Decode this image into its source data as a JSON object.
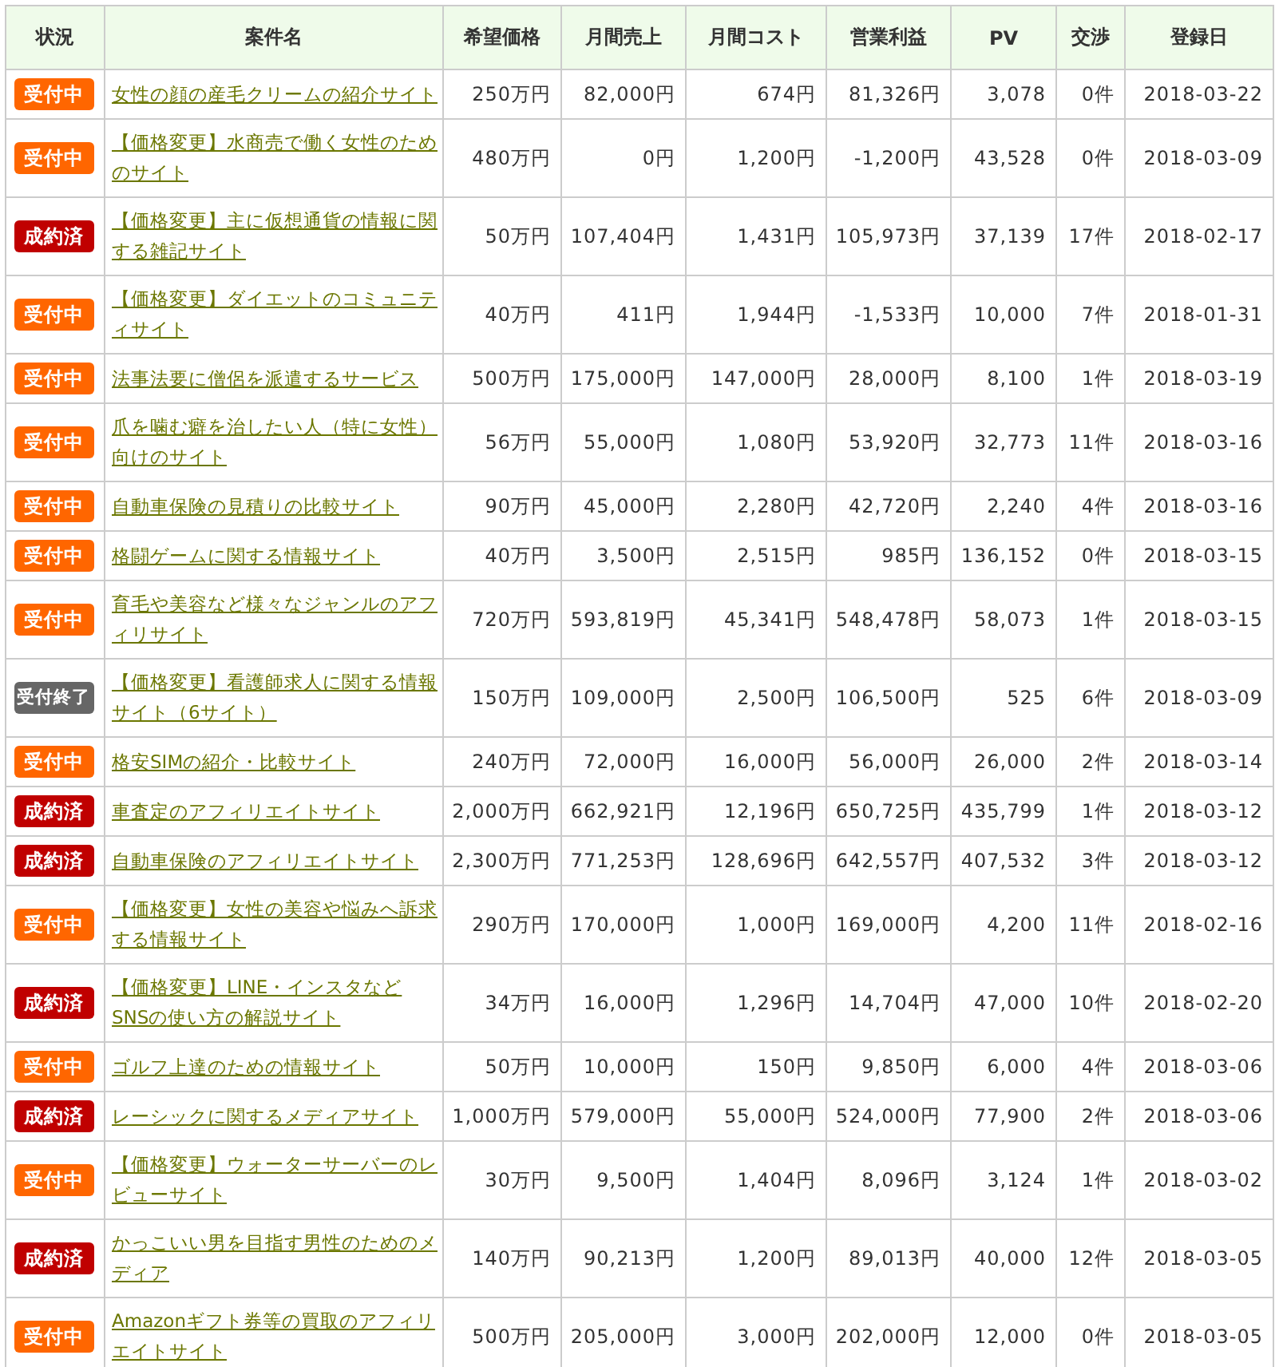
{
  "table": {
    "columns": [
      "状況",
      "案件名",
      "希望価格",
      "月間売上",
      "月間コスト",
      "営業利益",
      "PV",
      "交渉",
      "登録日"
    ],
    "rows": [
      {
        "status": {
          "label": "受付中",
          "kind": "open"
        },
        "name": "女性の顔の産毛クリームの紹介サイト",
        "price": "250万円",
        "sales": "82,000円",
        "cost": "674円",
        "profit": "81,326円",
        "pv": "3,078",
        "offers": "0件",
        "date": "2018-03-22"
      },
      {
        "status": {
          "label": "受付中",
          "kind": "open"
        },
        "name": "【価格変更】水商売で働く女性のためのサイト",
        "price": "480万円",
        "sales": "0円",
        "cost": "1,200円",
        "profit": "-1,200円",
        "pv": "43,528",
        "offers": "0件",
        "date": "2018-03-09"
      },
      {
        "status": {
          "label": "成約済",
          "kind": "closed"
        },
        "name": "【価格変更】主に仮想通貨の情報に関する雑記サイト",
        "price": "50万円",
        "sales": "107,404円",
        "cost": "1,431円",
        "profit": "105,973円",
        "pv": "37,139",
        "offers": "17件",
        "date": "2018-02-17"
      },
      {
        "status": {
          "label": "受付中",
          "kind": "open"
        },
        "name": "【価格変更】ダイエットのコミュニティサイト",
        "price": "40万円",
        "sales": "411円",
        "cost": "1,944円",
        "profit": "-1,533円",
        "pv": "10,000",
        "offers": "7件",
        "date": "2018-01-31"
      },
      {
        "status": {
          "label": "受付中",
          "kind": "open"
        },
        "name": "法事法要に僧侶を派遣するサービス",
        "price": "500万円",
        "sales": "175,000円",
        "cost": "147,000円",
        "profit": "28,000円",
        "pv": "8,100",
        "offers": "1件",
        "date": "2018-03-19"
      },
      {
        "status": {
          "label": "受付中",
          "kind": "open"
        },
        "name": "爪を噛む癖を治したい人（特に女性）向けのサイト",
        "price": "56万円",
        "sales": "55,000円",
        "cost": "1,080円",
        "profit": "53,920円",
        "pv": "32,773",
        "offers": "11件",
        "date": "2018-03-16"
      },
      {
        "status": {
          "label": "受付中",
          "kind": "open"
        },
        "name": "自動車保険の見積りの比較サイト",
        "price": "90万円",
        "sales": "45,000円",
        "cost": "2,280円",
        "profit": "42,720円",
        "pv": "2,240",
        "offers": "4件",
        "date": "2018-03-16"
      },
      {
        "status": {
          "label": "受付中",
          "kind": "open"
        },
        "name": "格闘ゲームに関する情報サイト",
        "price": "40万円",
        "sales": "3,500円",
        "cost": "2,515円",
        "profit": "985円",
        "pv": "136,152",
        "offers": "0件",
        "date": "2018-03-15"
      },
      {
        "status": {
          "label": "受付中",
          "kind": "open"
        },
        "name": "育毛や美容など様々なジャンルのアフィリサイト",
        "price": "720万円",
        "sales": "593,819円",
        "cost": "45,341円",
        "profit": "548,478円",
        "pv": "58,073",
        "offers": "1件",
        "date": "2018-03-15"
      },
      {
        "status": {
          "label": "受付終了",
          "kind": "ended"
        },
        "name": "【価格変更】看護師求人に関する情報サイト（6サイト）",
        "price": "150万円",
        "sales": "109,000円",
        "cost": "2,500円",
        "profit": "106,500円",
        "pv": "525",
        "offers": "6件",
        "date": "2018-03-09"
      },
      {
        "status": {
          "label": "受付中",
          "kind": "open"
        },
        "name": "格安SIMの紹介・比較サイト",
        "price": "240万円",
        "sales": "72,000円",
        "cost": "16,000円",
        "profit": "56,000円",
        "pv": "26,000",
        "offers": "2件",
        "date": "2018-03-14"
      },
      {
        "status": {
          "label": "成約済",
          "kind": "closed"
        },
        "name": "車査定のアフィリエイトサイト",
        "price": "2,000万円",
        "sales": "662,921円",
        "cost": "12,196円",
        "profit": "650,725円",
        "pv": "435,799",
        "offers": "1件",
        "date": "2018-03-12"
      },
      {
        "status": {
          "label": "成約済",
          "kind": "closed"
        },
        "name": "自動車保険のアフィリエイトサイト",
        "price": "2,300万円",
        "sales": "771,253円",
        "cost": "128,696円",
        "profit": "642,557円",
        "pv": "407,532",
        "offers": "3件",
        "date": "2018-03-12"
      },
      {
        "status": {
          "label": "受付中",
          "kind": "open"
        },
        "name": "【価格変更】女性の美容や悩みへ訴求する情報サイト",
        "price": "290万円",
        "sales": "170,000円",
        "cost": "1,000円",
        "profit": "169,000円",
        "pv": "4,200",
        "offers": "11件",
        "date": "2018-02-16"
      },
      {
        "status": {
          "label": "成約済",
          "kind": "closed"
        },
        "name": "【価格変更】LINE・インスタなどSNSの使い方の解説サイト",
        "price": "34万円",
        "sales": "16,000円",
        "cost": "1,296円",
        "profit": "14,704円",
        "pv": "47,000",
        "offers": "10件",
        "date": "2018-02-20"
      },
      {
        "status": {
          "label": "受付中",
          "kind": "open"
        },
        "name": "ゴルフ上達のための情報サイト",
        "price": "50万円",
        "sales": "10,000円",
        "cost": "150円",
        "profit": "9,850円",
        "pv": "6,000",
        "offers": "4件",
        "date": "2018-03-06"
      },
      {
        "status": {
          "label": "成約済",
          "kind": "closed"
        },
        "name": "レーシックに関するメディアサイト",
        "price": "1,000万円",
        "sales": "579,000円",
        "cost": "55,000円",
        "profit": "524,000円",
        "pv": "77,900",
        "offers": "2件",
        "date": "2018-03-06"
      },
      {
        "status": {
          "label": "受付中",
          "kind": "open"
        },
        "name": "【価格変更】ウォーターサーバーのレビューサイト",
        "price": "30万円",
        "sales": "9,500円",
        "cost": "1,404円",
        "profit": "8,096円",
        "pv": "3,124",
        "offers": "1件",
        "date": "2018-03-02"
      },
      {
        "status": {
          "label": "成約済",
          "kind": "closed"
        },
        "name": "かっこいい男を目指す男性のためのメディア",
        "price": "140万円",
        "sales": "90,213円",
        "cost": "1,200円",
        "profit": "89,013円",
        "pv": "40,000",
        "offers": "12件",
        "date": "2018-03-05"
      },
      {
        "status": {
          "label": "受付中",
          "kind": "open"
        },
        "name": "Amazonギフト券等の買取のアフィリエイトサイト",
        "price": "500万円",
        "sales": "205,000円",
        "cost": "3,000円",
        "profit": "202,000円",
        "pv": "12,000",
        "offers": "0件",
        "date": "2018-03-05"
      }
    ]
  }
}
